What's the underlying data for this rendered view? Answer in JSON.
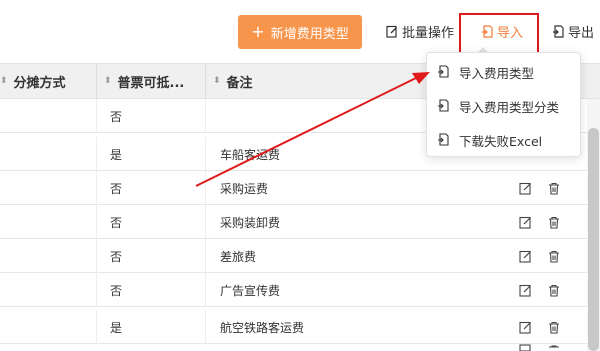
{
  "toolbar": {
    "add_label": "新增费用类型",
    "batch_label": "批量操作",
    "import_label": "导入",
    "export_label": "导出"
  },
  "table": {
    "columns": [
      "分摊方式",
      "普票可抵...",
      "备注"
    ],
    "rows": [
      {
        "invoice": "否",
        "note": ""
      },
      {
        "invoice": "是",
        "note": "车船客运费"
      },
      {
        "invoice": "否",
        "note": "采购运费"
      },
      {
        "invoice": "否",
        "note": "采购装卸费"
      },
      {
        "invoice": "否",
        "note": "差旅费"
      },
      {
        "invoice": "否",
        "note": "广告宣传费"
      },
      {
        "invoice": "是",
        "note": "航空铁路客运费"
      }
    ]
  },
  "import_menu": {
    "items": [
      {
        "label": "导入费用类型"
      },
      {
        "label": "导入费用类型分类"
      },
      {
        "label": "下载失败Excel"
      }
    ]
  },
  "colors": {
    "accent": "#f7954c",
    "import_text": "#f17d3a",
    "highlight": "#e0191b"
  }
}
